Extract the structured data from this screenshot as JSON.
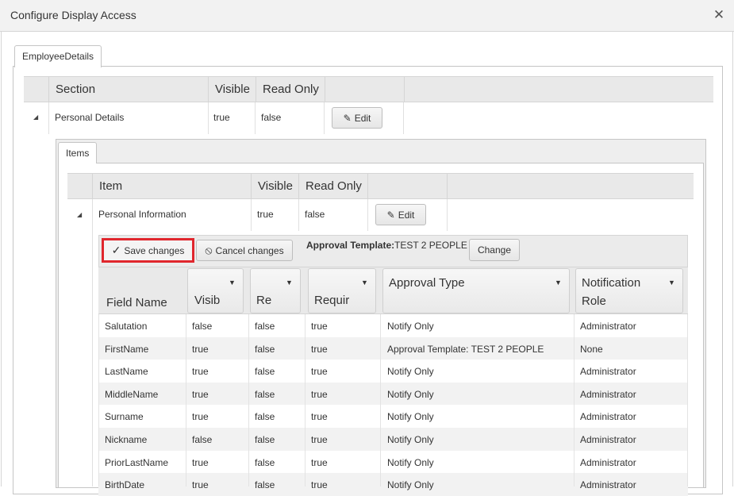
{
  "window": {
    "title": "Configure Display Access",
    "close_glyph": "✕"
  },
  "outer_tab": "EmployeeDetails",
  "sections_grid": {
    "columns": [
      "Section",
      "Visible",
      "Read Only"
    ],
    "row": {
      "section": "Personal Details",
      "visible": "true",
      "read_only": "false",
      "edit_label": "Edit"
    }
  },
  "inner_tab": "Items",
  "items_grid": {
    "columns": [
      "Item",
      "Visible",
      "Read Only"
    ],
    "row": {
      "item": "Personal Information",
      "visible": "true",
      "read_only": "false",
      "edit_label": "Edit"
    }
  },
  "toolbar": {
    "save_label": "Save changes",
    "cancel_label": "Cancel changes",
    "approval_label": "Approval Template:",
    "approval_value": "TEST 2 PEOPLE",
    "change_label": "Change"
  },
  "fields_grid": {
    "columns": [
      "Field Name",
      "Visib",
      "Re",
      "Requir",
      "Approval Type",
      "Notification",
      "Role"
    ],
    "rows": [
      [
        "Salutation",
        "false",
        "false",
        "true",
        "Notify Only",
        "Administrator"
      ],
      [
        "FirstName",
        "true",
        "false",
        "true",
        "Approval Template: TEST 2 PEOPLE",
        "None"
      ],
      [
        "LastName",
        "true",
        "false",
        "true",
        "Notify Only",
        "Administrator"
      ],
      [
        "MiddleName",
        "true",
        "false",
        "true",
        "Notify Only",
        "Administrator"
      ],
      [
        "Surname",
        "true",
        "false",
        "true",
        "Notify Only",
        "Administrator"
      ],
      [
        "Nickname",
        "false",
        "false",
        "true",
        "Notify Only",
        "Administrator"
      ],
      [
        "PriorLastName",
        "true",
        "false",
        "true",
        "Notify Only",
        "Administrator"
      ],
      [
        "BirthDate",
        "true",
        "false",
        "true",
        "Notify Only",
        "Administrator"
      ]
    ]
  },
  "colors": {
    "highlight": "#e0262d",
    "header_bg": "#e9e9e9",
    "alt_row": "#f2f2f2"
  }
}
